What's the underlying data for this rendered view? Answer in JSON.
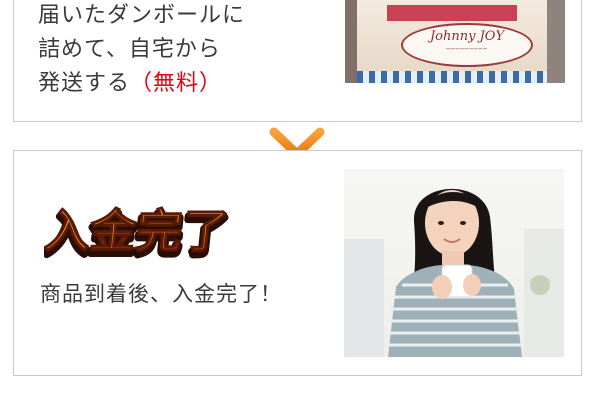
{
  "step_shipping": {
    "lines": [
      "届いたダンボールに",
      "詰めて、自宅から",
      "発送する"
    ],
    "free_note": "（無料）",
    "box_label_title": "Johnny JOY"
  },
  "step_payment": {
    "title": "入金完了",
    "description": "商品到着後、入金完了！"
  },
  "colors": {
    "accent_orange": "#f08a1c",
    "free_red": "#e60012",
    "border": "#c9c9c9"
  },
  "icons": {
    "arrow": "arrow-down-icon"
  }
}
